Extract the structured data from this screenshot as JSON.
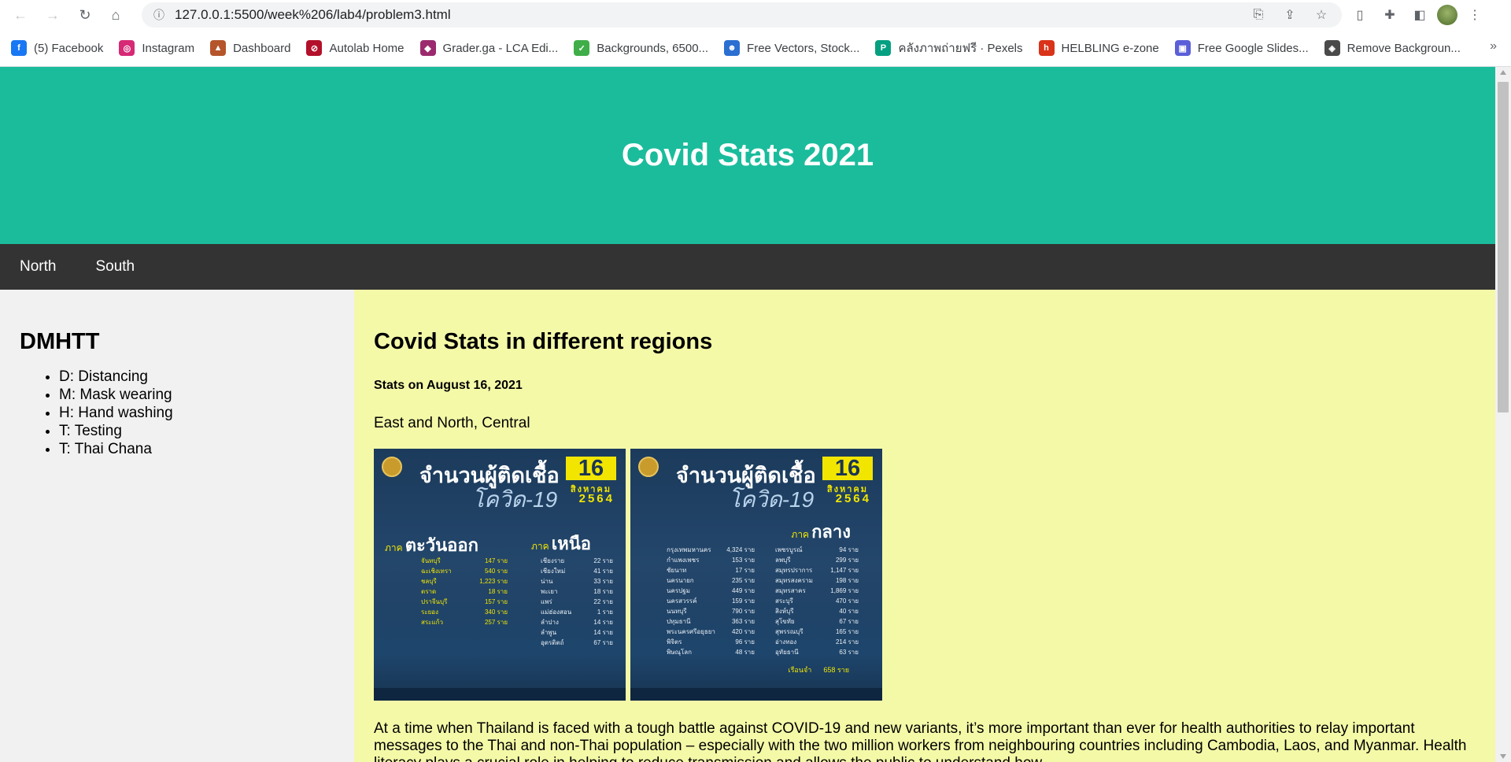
{
  "browser": {
    "url": "127.0.0.1:5500/week%206/lab4/problem3.html",
    "bookmarks": [
      {
        "label": "(5) Facebook",
        "icon": "facebook-icon",
        "color": "#1877f2",
        "glyph": "f"
      },
      {
        "label": "Instagram",
        "icon": "instagram-icon",
        "color": "#d62976",
        "glyph": "◎"
      },
      {
        "label": "Dashboard",
        "icon": "flame-icon",
        "color": "#b5552b",
        "glyph": "▲"
      },
      {
        "label": "Autolab Home",
        "icon": "autolab-icon",
        "color": "#b3102b",
        "glyph": "⊘"
      },
      {
        "label": "Grader.ga - LCA Edi...",
        "icon": "grader-icon",
        "color": "#9b2a6e",
        "glyph": "◆"
      },
      {
        "label": "Backgrounds, 6500...",
        "icon": "backgrounds-icon",
        "color": "#3fae49",
        "glyph": "✓"
      },
      {
        "label": "Free Vectors, Stock...",
        "icon": "freepik-icon",
        "color": "#2a6fd1",
        "glyph": "☻"
      },
      {
        "label": "คลังภาพถ่ายฟรี · Pexels",
        "icon": "pexels-icon",
        "color": "#05a081",
        "glyph": "P"
      },
      {
        "label": "HELBLING e-zone",
        "icon": "helbling-icon",
        "color": "#d9331a",
        "glyph": "h"
      },
      {
        "label": "Free Google Slides...",
        "icon": "slides-icon",
        "color": "#5b5fd8",
        "glyph": "▣"
      },
      {
        "label": "Remove Backgroun...",
        "icon": "removebg-icon",
        "color": "#4a4a4a",
        "glyph": "◈"
      }
    ],
    "more": "»"
  },
  "header": {
    "title": "Covid Stats 2021"
  },
  "topnav": {
    "items": [
      "North",
      "South"
    ]
  },
  "side": {
    "heading": "DMHTT",
    "items": [
      "D: Distancing",
      "M: Mask wearing",
      "H: Hand washing",
      "T: Testing",
      "T: Thai Chana"
    ]
  },
  "main": {
    "heading": "Covid Stats in different regions",
    "subheading": "Stats on August 16, 2021",
    "region_caption": "East and North, Central",
    "body": "At a time when Thailand is faced with a tough battle against COVID-19 and new variants, it’s more important than ever for health authorities to relay important messages to the Thai and non-Thai population – especially with the two million workers from neighbouring countries including Cambodia, Laos, and Myanmar. Health literacy plays a crucial role in helping to reduce transmission and allows the public to understand how"
  },
  "infographic_common": {
    "title": "จำนวนผู้ติดเชื้อ",
    "subtitle": "โควิด-19",
    "day": "16",
    "month": "สิงหาคม",
    "year": "2564"
  },
  "infographic_east_north": {
    "region1_prefix": "ภาค",
    "region1": "ตะวันออก",
    "region2_prefix": "ภาค",
    "region2": "เหนือ",
    "east_list": [
      [
        "จันทบุรี",
        "147 ราย"
      ],
      [
        "ฉะเชิงเทรา",
        "540 ราย"
      ],
      [
        "ชลบุรี",
        "1,223 ราย"
      ],
      [
        "ตราด",
        "18 ราย"
      ],
      [
        "ปราจีนบุรี",
        "157 ราย"
      ],
      [
        "ระยอง",
        "340 ราย"
      ],
      [
        "สระแก้ว",
        "257 ราย"
      ]
    ],
    "north_list": [
      [
        "เชียงราย",
        "22 ราย"
      ],
      [
        "เชียงใหม่",
        "41 ราย"
      ],
      [
        "น่าน",
        "33 ราย"
      ],
      [
        "พะเยา",
        "18 ราย"
      ],
      [
        "แพร่",
        "22 ราย"
      ],
      [
        "แม่ฮ่องสอน",
        "1 ราย"
      ],
      [
        "ลำปาง",
        "14 ราย"
      ],
      [
        "ลำพูน",
        "14 ราย"
      ],
      [
        "อุตรดิตถ์",
        "67 ราย"
      ]
    ]
  },
  "infographic_central": {
    "region_prefix": "ภาค",
    "region": "กลาง",
    "left_list": [
      [
        "กรุงเทพมหานคร",
        "4,324 ราย"
      ],
      [
        "กำแพงเพชร",
        "153 ราย"
      ],
      [
        "ชัยนาท",
        "17 ราย"
      ],
      [
        "นครนายก",
        "235 ราย"
      ],
      [
        "นครปฐม",
        "449 ราย"
      ],
      [
        "นครสวรรค์",
        "159 ราย"
      ],
      [
        "นนทบุรี",
        "790 ราย"
      ],
      [
        "ปทุมธานี",
        "363 ราย"
      ],
      [
        "พระนครศรีอยุธยา",
        "420 ราย"
      ],
      [
        "พิจิตร",
        "96 ราย"
      ],
      [
        "พิษณุโลก",
        "48 ราย"
      ]
    ],
    "right_list": [
      [
        "เพชรบูรณ์",
        "94 ราย"
      ],
      [
        "ลพบุรี",
        "299 ราย"
      ],
      [
        "สมุทรปราการ",
        "1,147 ราย"
      ],
      [
        "สมุทรสงคราม",
        "198 ราย"
      ],
      [
        "สมุทรสาคร",
        "1,869 ราย"
      ],
      [
        "สระบุรี",
        "470 ราย"
      ],
      [
        "สิงห์บุรี",
        "40 ราย"
      ],
      [
        "สุโขทัย",
        "67 ราย"
      ],
      [
        "สุพรรณบุรี",
        "165 ราย"
      ],
      [
        "อ่างทอง",
        "214 ราย"
      ],
      [
        "อุทัยธานี",
        "63 ราย"
      ]
    ],
    "total_label": "เรือนจำ",
    "total_value": "658 ราย"
  }
}
